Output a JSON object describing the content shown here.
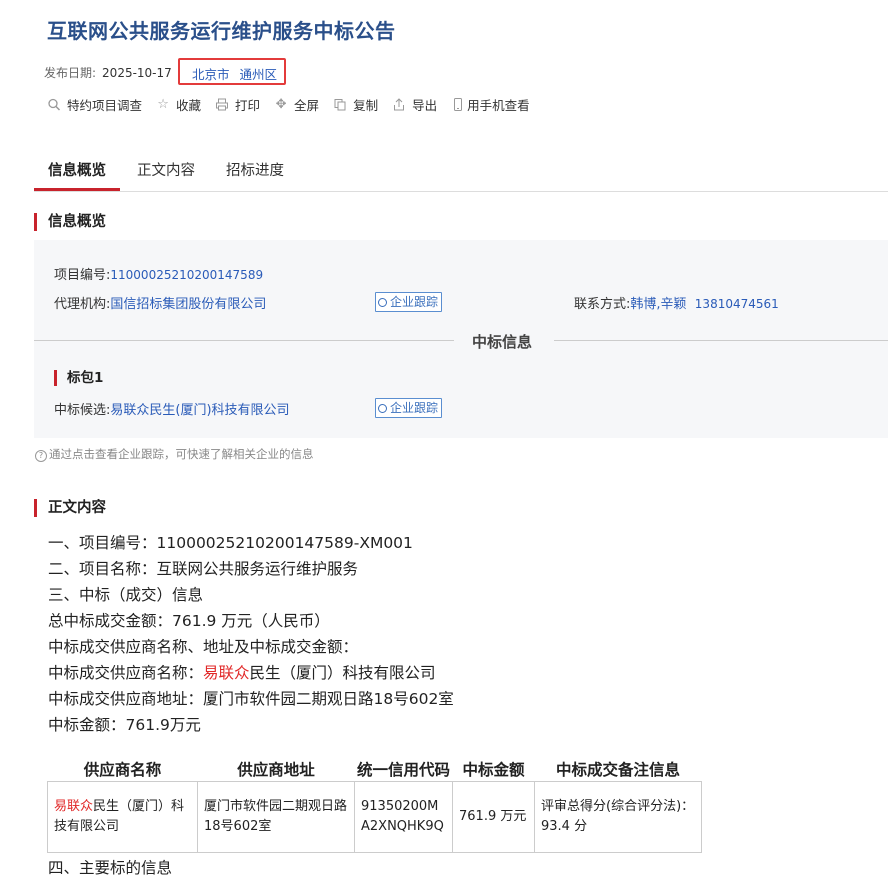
{
  "title": "互联网公共服务运行维护服务中标公告",
  "meta": {
    "publish_label": "发布日期:",
    "publish_date": "2025-10-17",
    "city": "北京市",
    "district": "通州区"
  },
  "toolbar": [
    {
      "icon": "search-icon",
      "label": "特约项目调查"
    },
    {
      "icon": "star-icon",
      "label": "收藏"
    },
    {
      "icon": "printer-icon",
      "label": "打印"
    },
    {
      "icon": "fullscreen-icon",
      "label": "全屏"
    },
    {
      "icon": "copy-icon",
      "label": "复制"
    },
    {
      "icon": "export-icon",
      "label": "导出"
    },
    {
      "icon": "phone-icon",
      "label": "用手机查看"
    }
  ],
  "tabs": [
    "信息概览",
    "正文内容",
    "招标进度"
  ],
  "overview": {
    "heading": "信息概览",
    "project_no_label": "项目编号:",
    "project_no": "11000025210200147589",
    "agency_label": "代理机构:",
    "agency": "国信招标集团股份有限公司",
    "track_label": "企业跟踪",
    "contact_label": "联系方式:",
    "contact_names": "韩博,辛颖",
    "contact_phone": "13810474561",
    "win_info_label": "中标信息",
    "package_label": "标包1",
    "candidate_label": "中标候选:",
    "candidate": "易联众民生(厦门)科技有限公司",
    "hint": "通过点击查看企业跟踪，可快速了解相关企业的信息"
  },
  "content": {
    "heading": "正文内容",
    "lines": {
      "l1": "一、项目编号：11000025210200147589-XM001",
      "l2": "二、项目名称：互联网公共服务运行维护服务",
      "l3": "三、中标（成交）信息",
      "l4": "总中标成交金额：761.9 万元（人民币）",
      "l5": "中标成交供应商名称、地址及中标成交金额：",
      "l6_pre": "中标成交供应商名称：",
      "l6_red": "易联众",
      "l6_post": "民生（厦门）科技有限公司",
      "l7": "中标成交供应商地址：厦门市软件园二期观日路18号602室",
      "l8": "中标金额：761.9万元"
    },
    "table": {
      "headers": [
        "供应商名称",
        "供应商地址",
        "统一信用代码",
        "中标金额",
        "中标成交备注信息"
      ],
      "row": {
        "name_red": "易联众",
        "name_rest": "民生（厦门）科技有限公司",
        "address": "厦门市软件园二期观日路18号602室",
        "credit_code": "91350200MA2XNQHK9Q",
        "amount": "761.9 万元",
        "remark": "评审总得分(综合评分法)： 93.4 分"
      }
    },
    "next_line": "四、主要标的信息"
  }
}
